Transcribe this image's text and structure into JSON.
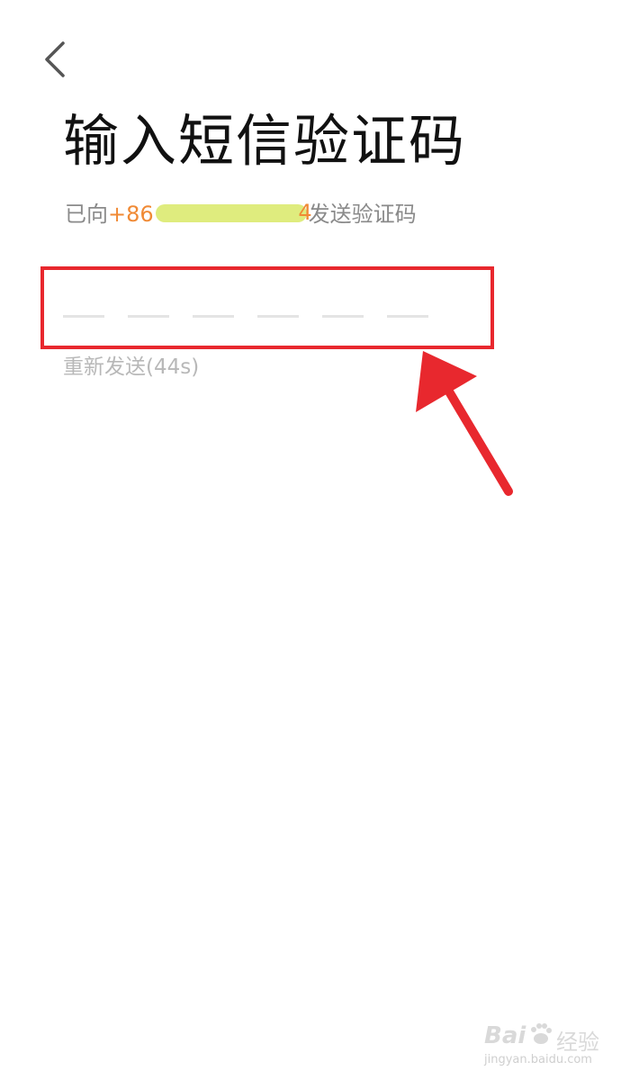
{
  "header": {
    "back_icon": "chevron-left-icon"
  },
  "title": "输入短信验证码",
  "subtitle": {
    "prefix": "已向",
    "country_code": "+86",
    "phone_tail": "4",
    "suffix": "发送验证码"
  },
  "code_input": {
    "slot_count": 6,
    "value": ""
  },
  "resend": {
    "label": "重新发送(44s)"
  },
  "watermark": {
    "brand": "Bai",
    "brand_cn": "经验",
    "url": "jingyan.baidu.com"
  },
  "colors": {
    "accent_orange": "#f08a35",
    "highlight_red": "#e8282e",
    "redaction_yellow": "#dfec7e"
  }
}
